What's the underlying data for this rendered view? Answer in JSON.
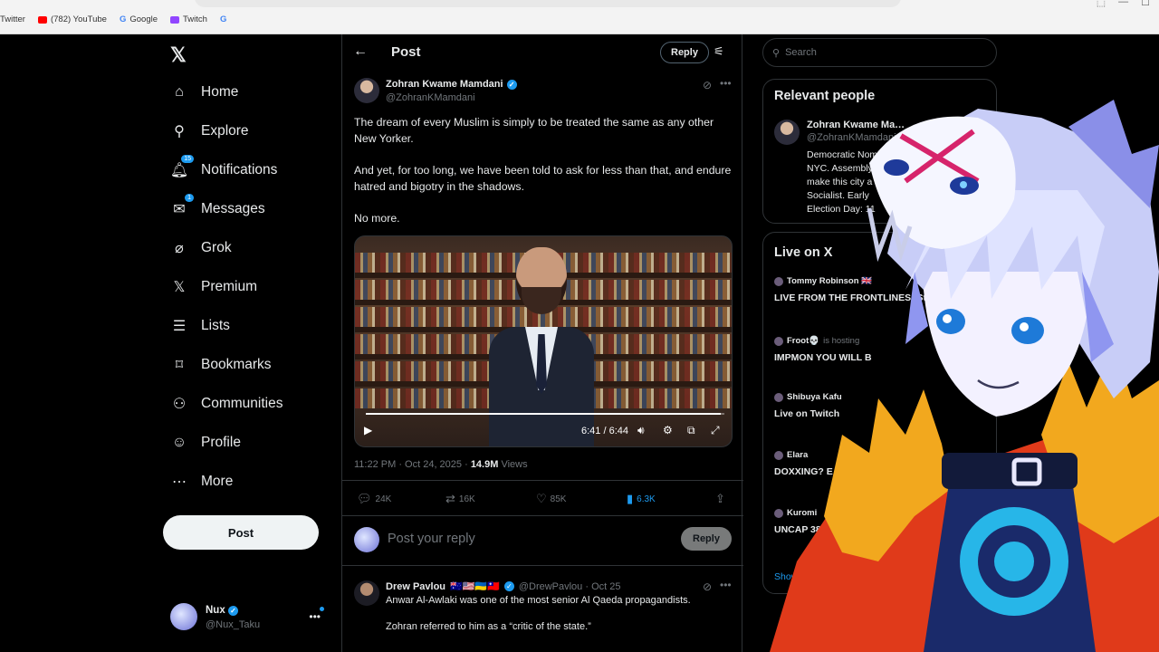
{
  "browser": {
    "url": "x.com/ZohranKMamdani/status/1981921554413469955",
    "bookmarks": [
      {
        "label": "Twitter",
        "color": "#000000"
      },
      {
        "label": "(782) YouTube",
        "color": "#ff0000"
      },
      {
        "label": "Google",
        "color": "#4285f4"
      },
      {
        "label": "Twitch",
        "color": "#9146ff"
      },
      {
        "label": "",
        "color": "#4285f4"
      }
    ]
  },
  "nav": {
    "items": [
      {
        "label": "Home",
        "icon": "home-icon",
        "glyph": "⌂"
      },
      {
        "label": "Explore",
        "icon": "search-icon",
        "glyph": "⚲"
      },
      {
        "label": "Notifications",
        "icon": "bell-icon",
        "glyph": "🔔︎",
        "badge": "15"
      },
      {
        "label": "Messages",
        "icon": "mail-icon",
        "glyph": "✉",
        "badge": "1"
      },
      {
        "label": "Grok",
        "icon": "grok-icon",
        "glyph": "⌀"
      },
      {
        "label": "Premium",
        "icon": "x-icon",
        "glyph": "𝕏"
      },
      {
        "label": "Lists",
        "icon": "list-icon",
        "glyph": "☰"
      },
      {
        "label": "Bookmarks",
        "icon": "bookmark-icon",
        "glyph": "⌑"
      },
      {
        "label": "Communities",
        "icon": "people-icon",
        "glyph": "⚇"
      },
      {
        "label": "Profile",
        "icon": "person-icon",
        "glyph": "☺"
      },
      {
        "label": "More",
        "icon": "more-circle-icon",
        "glyph": "⋯"
      }
    ],
    "post_label": "Post",
    "account": {
      "name": "Nux",
      "handle": "@Nux_Taku"
    }
  },
  "main": {
    "title": "Post",
    "reply_label": "Reply",
    "tweet": {
      "author_name": "Zohran Kwame Mamdani",
      "author_handle": "@ZohranKMamdani",
      "paragraphs": [
        "The dream of every Muslim is simply to be treated the same as any other New Yorker.",
        "And yet, for too long, we have been told to ask for less than that, and endure hatred and bigotry in the shadows.",
        "No more."
      ],
      "video": {
        "time": "6:41 / 6:44",
        "progress": 0.99
      },
      "timestamp": "11:22 PM · Oct 24, 2025 · ",
      "views_count": "14.9M",
      "views_label": " Views",
      "stats": {
        "replies": "24K",
        "reposts": "16K",
        "likes": "85K",
        "bookmarks": "6.3K"
      }
    },
    "reply_box": {
      "placeholder": "Post your reply",
      "button": "Reply"
    },
    "comment": {
      "name": "Drew Pavlou",
      "flags": "🇦🇺🇺🇸🇺🇦🇹🇼",
      "handle": "@DrewPavlou · Oct 25",
      "lines": [
        "Anwar Al-Awlaki was one of the most senior Al Qaeda propagandists.",
        "Zohran referred to him as a “critic of the state.”"
      ]
    }
  },
  "sidebar": {
    "search_placeholder": "Search",
    "relevant_title": "Relevant people",
    "person": {
      "name": "Zohran Kwame Ma…",
      "handle": "@ZohranKMamdani",
      "bio": "Democratic Nomi NYC. Assembly make this city a Socialist. Early Election Day: 11"
    },
    "live_title": "Live on X",
    "live": [
      {
        "host": "Tommy Robinson 🇬🇧",
        "hosting": "",
        "title": "LIVE FROM THE FRONTLINES: Standing ..."
      },
      {
        "host": "Froot💀",
        "hosting": "is hosting",
        "title": "IMPMON YOU WILL B"
      },
      {
        "host": "Shibuya Kafu",
        "hosting": "",
        "title": "Live on Twitch"
      },
      {
        "host": "Elara",
        "hosting": "",
        "title": "DOXXING? E MEMBER ACC"
      },
      {
        "host": "Kuromi",
        "hosting": "",
        "title": "UNCAP 38 + F"
      }
    ],
    "show_more": "Show"
  },
  "colors": {
    "accent": "#1d9bf0",
    "background": "#000000",
    "border": "#2f3336",
    "muted": "#71767b"
  }
}
